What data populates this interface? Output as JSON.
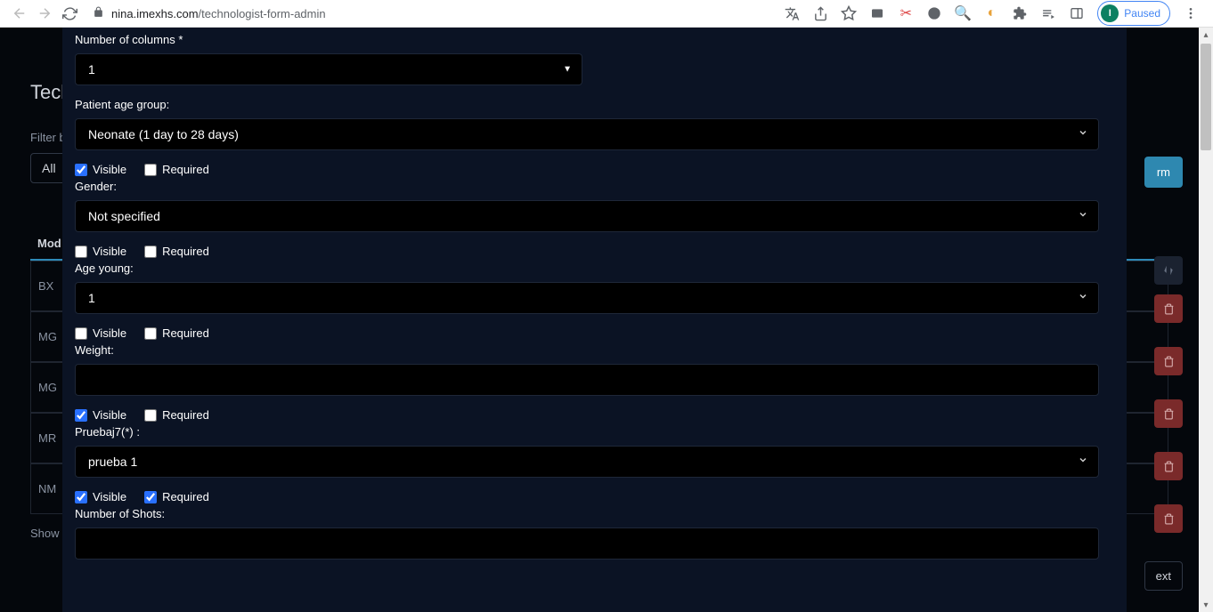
{
  "browser": {
    "host": "nina.imexhs.com",
    "path": "/technologist-form-admin",
    "paused_label": "Paused",
    "avatar_initial": "I"
  },
  "background": {
    "title_partial": "Tech",
    "filter_label": "Filter b",
    "filter_value": "All",
    "table_header": "Mod",
    "rows": [
      "BX",
      "MG",
      "MG",
      "MR",
      "NM"
    ],
    "show_label": "Show",
    "right_btn_partial": "rm",
    "next_partial": "ext"
  },
  "form": {
    "columns_label": "Number of columns *",
    "columns_value": "1",
    "age_group_label": "Patient age group:",
    "age_group_value": "Neonate (1 day to 28 days)",
    "gender_label": "Gender:",
    "gender_value": "Not specified",
    "age_young_label": "Age young:",
    "age_young_value": "1",
    "weight_label": "Weight:",
    "weight_value": "",
    "pruebaj7_label": "Pruebaj7(*) :",
    "pruebaj7_value": "prueba 1",
    "shots_label": "Number of Shots:",
    "shots_value": "",
    "visible_label": "Visible",
    "required_label": "Required",
    "vis_req": {
      "age_group": {
        "visible": true,
        "required": false
      },
      "gender": {
        "visible": false,
        "required": false
      },
      "age_young": {
        "visible": false,
        "required": false
      },
      "weight": {
        "visible": true,
        "required": false
      },
      "pruebaj7": {
        "visible": true,
        "required": true
      }
    }
  }
}
